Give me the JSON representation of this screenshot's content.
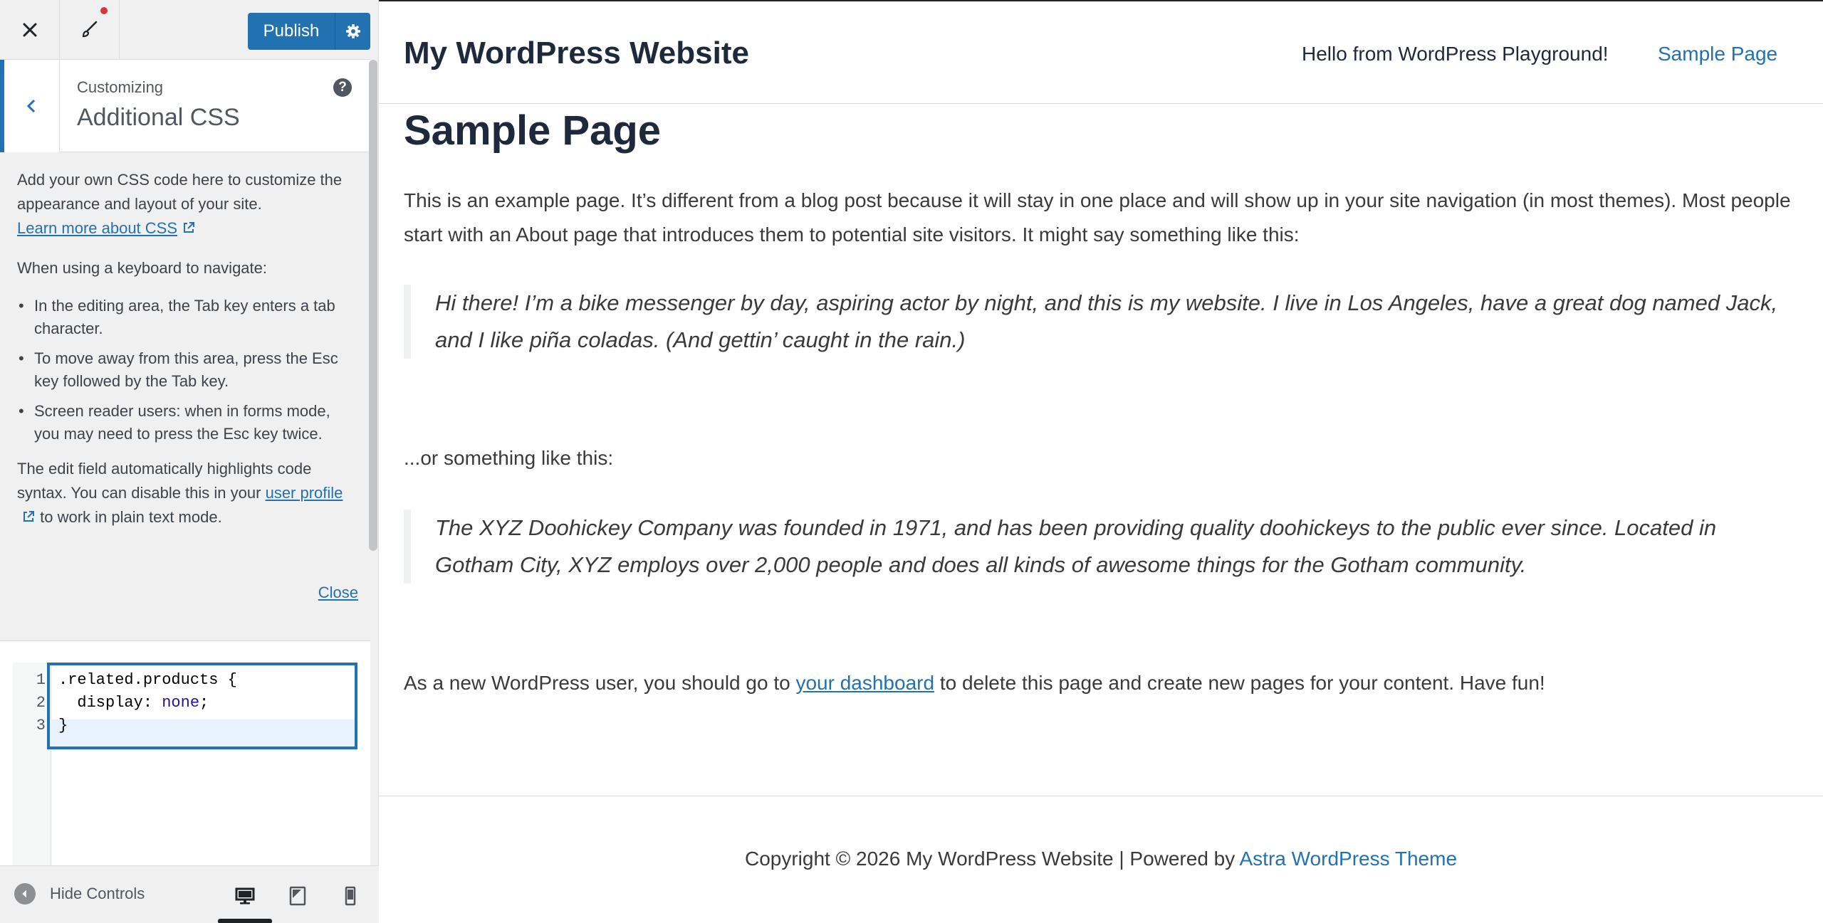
{
  "sidebar": {
    "publish_label": "Publish",
    "customizing_label": "Customizing",
    "section_title": "Additional CSS",
    "help_label": "?",
    "description": {
      "intro": "Add your own CSS code here to customize the appearance and layout of your site.",
      "learn_more": "Learn more about CSS",
      "keyboard_intro": "When using a keyboard to navigate:",
      "tips": [
        "In the editing area, the Tab key enters a tab character.",
        "To move away from this area, press the Esc key followed by the Tab key.",
        "Screen reader users: when in forms mode, you may need to press the Esc key twice."
      ],
      "syntax_pre": "The edit field automatically highlights code syntax. You can disable this in your",
      "user_profile": "user profile",
      "syntax_post": "to work in plain text mode.",
      "close": "Close"
    },
    "editor": {
      "line_numbers": [
        "1",
        "2",
        "3"
      ],
      "lines": {
        "l1": ".related.products {",
        "l2_prop": "  display: ",
        "l2_val": "none",
        "l2_end": ";",
        "l3": "}"
      }
    },
    "footer": {
      "hide_controls": "Hide Controls"
    }
  },
  "preview": {
    "site_title": "My WordPress Website",
    "nav": [
      "Hello from WordPress Playground!",
      "Sample Page"
    ],
    "page_title": "Sample Page",
    "p1": "This is an example page. It’s different from a blog post because it will stay in one place and will show up in your site navigation (in most themes). Most people start with an About page that introduces them to potential site visitors. It might say something like this:",
    "quote1": "Hi there! I’m a bike messenger by day, aspiring actor by night, and this is my website. I live in Los Angeles, have a great dog named Jack, and I like piña coladas. (And gettin’ caught in the rain.)",
    "p2": "...or something like this:",
    "quote2": "The XYZ Doohickey Company was founded in 1971, and has been providing quality doohickeys to the public ever since. Located in Gotham City, XYZ employs over 2,000 people and does all kinds of awesome things for the Gotham community.",
    "p3_pre": "As a new WordPress user, you should go to",
    "p3_link": "your dashboard",
    "p3_post": "to delete this page and create new pages for your content. Have fun!",
    "copyright_pre": "Copyright © 2026 My WordPress Website | Powered by",
    "copyright_link": "Astra WordPress Theme"
  },
  "colors": {
    "accent": "#2271b1",
    "sidebar_bg": "#f0f0f1",
    "notification": "#d63638"
  }
}
